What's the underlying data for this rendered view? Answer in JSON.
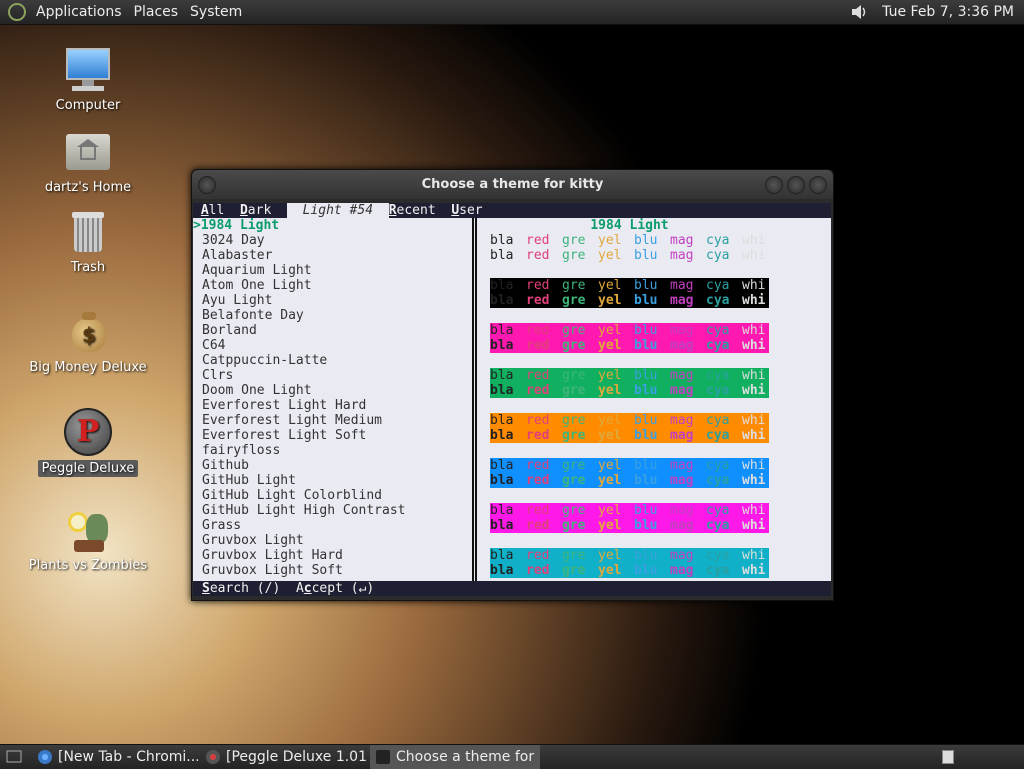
{
  "top_panel": {
    "menus": [
      "Applications",
      "Places",
      "System"
    ],
    "clock": "Tue Feb  7,  3:36 PM"
  },
  "desktop_icons": [
    {
      "label": "Computer"
    },
    {
      "label": "dartz's Home"
    },
    {
      "label": "Trash"
    },
    {
      "label": "Big Money Deluxe"
    },
    {
      "label": "Peggle Deluxe"
    },
    {
      "label": "Plants vs Zombies"
    }
  ],
  "window": {
    "title": "Choose a theme for kitty"
  },
  "terminal": {
    "tabs": {
      "all": "All",
      "dark": "Dark",
      "light": "Light #54",
      "recent": "Recent",
      "user": "User"
    },
    "themes": [
      ">1984 Light",
      "3024 Day",
      "Alabaster",
      "Aquarium Light",
      "Atom One Light",
      "Ayu Light",
      "Belafonte Day",
      "Borland",
      "C64",
      "Catppuccin-Latte",
      "Clrs",
      "Doom One Light",
      "Everforest Light Hard",
      "Everforest Light Medium",
      "Everforest Light Soft",
      "fairyfloss",
      "Github",
      "GitHub Light",
      "GitHub Light Colorblind",
      "GitHub Light High Contrast",
      "Grass",
      "Gruvbox Light",
      "Gruvbox Light Hard",
      "Gruvbox Light Soft"
    ],
    "preview_title": "1984 Light",
    "color_names": [
      "bla",
      "red",
      "gre",
      "yel",
      "blu",
      "mag",
      "cya",
      "whi"
    ],
    "status": {
      "search": "Search (/)",
      "accept": "Accept (↵)"
    }
  },
  "palette": {
    "fg": [
      "#222222",
      "#e0407a",
      "#3fb47a",
      "#e0a83a",
      "#3aa0e0",
      "#c040c0",
      "#2aa0a0",
      "#dddddd"
    ],
    "backgrounds": [
      "#eaeaf3",
      "#000000",
      "#ff19b0",
      "#10b060",
      "#ff8c00",
      "#1090ff",
      "#ff19e8",
      "#10b0c8"
    ]
  },
  "bottom_panel": {
    "tasks": [
      "[New Tab - Chromi...",
      "[Peggle Deluxe 1.01]",
      "Choose a theme for ..."
    ]
  }
}
